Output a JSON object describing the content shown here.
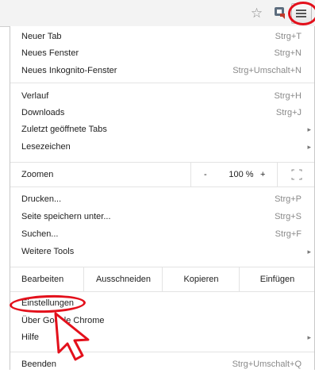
{
  "toolbar": {
    "star_icon": "star-outline-icon",
    "extension_icon": "extension-icon",
    "menu_icon": "hamburger-menu-icon"
  },
  "menu": {
    "group1": [
      {
        "label": "Neuer Tab",
        "shortcut": "Strg+T"
      },
      {
        "label": "Neues Fenster",
        "shortcut": "Strg+N"
      },
      {
        "label": "Neues Inkognito-Fenster",
        "shortcut": "Strg+Umschalt+N"
      }
    ],
    "group2": [
      {
        "label": "Verlauf",
        "shortcut": "Strg+H"
      },
      {
        "label": "Downloads",
        "shortcut": "Strg+J"
      },
      {
        "label": "Zuletzt geöffnete Tabs",
        "submenu": true
      },
      {
        "label": "Lesezeichen",
        "submenu": true
      }
    ],
    "zoom": {
      "label": "Zoomen",
      "minus": "-",
      "value": "100 %",
      "plus": "+"
    },
    "group3": [
      {
        "label": "Drucken...",
        "shortcut": "Strg+P"
      },
      {
        "label": "Seite speichern unter...",
        "shortcut": "Strg+S"
      },
      {
        "label": "Suchen...",
        "shortcut": "Strg+F"
      },
      {
        "label": "Weitere Tools",
        "submenu": true
      }
    ],
    "edit": {
      "label": "Bearbeiten",
      "cut": "Ausschneiden",
      "copy": "Kopieren",
      "paste": "Einfügen"
    },
    "group4": [
      {
        "label": "Einstellungen"
      },
      {
        "label": "Über Google Chrome"
      },
      {
        "label": "Hilfe",
        "submenu": true
      }
    ],
    "group5": [
      {
        "label": "Beenden",
        "shortcut": "Strg+Umschalt+Q"
      }
    ]
  },
  "annotation_color": "#e3101b"
}
